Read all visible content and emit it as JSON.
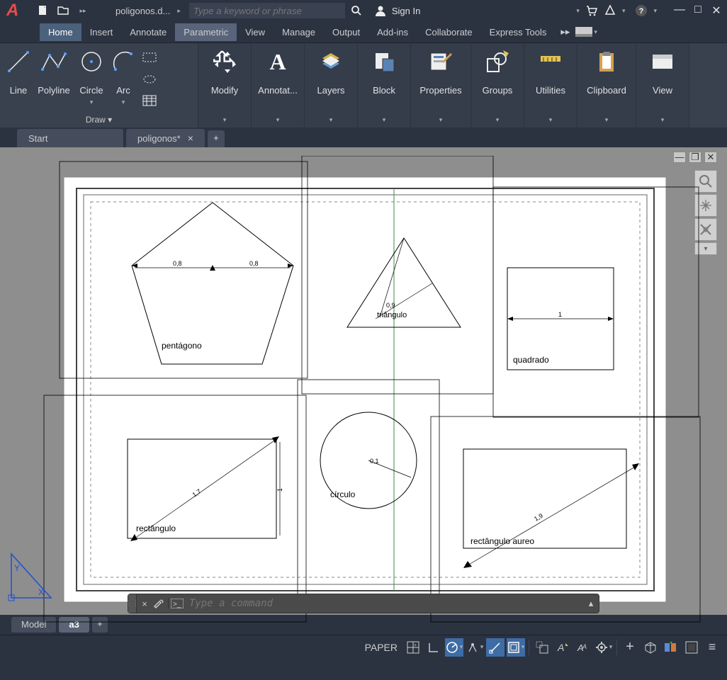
{
  "title": {
    "filename": "poligonos.d..."
  },
  "search": {
    "placeholder": "Type a keyword or phrase"
  },
  "signin": "Sign In",
  "menu": {
    "home": "Home",
    "insert": "Insert",
    "annotate": "Annotate",
    "parametric": "Parametric",
    "view": "View",
    "manage": "Manage",
    "output": "Output",
    "addins": "Add-ins",
    "collaborate": "Collaborate",
    "express": "Express Tools"
  },
  "ribbon": {
    "line": "Line",
    "polyline": "Polyline",
    "circle": "Circle",
    "arc": "Arc",
    "draw": "Draw ▾",
    "modify": "Modify",
    "annotation": "Annotat...",
    "layers": "Layers",
    "block": "Block",
    "properties": "Properties",
    "groups": "Groups",
    "utilities": "Utilities",
    "clipboard": "Clipboard",
    "view": "View"
  },
  "filetabs": {
    "start": "Start",
    "doc": "poligonos*"
  },
  "drawing": {
    "pentagon_label": "pentágono",
    "pentagon_dim1": "0,8",
    "pentagon_dim2": "0,8",
    "triangle_label": "triângulo",
    "triangle_dim": "0,9",
    "square_label": "quadrado",
    "square_dim": "1",
    "rect_label": "rectângulo",
    "rect_dim": "1,7",
    "rect_dim2": "1",
    "circle_label": "círculo",
    "circle_dim": "0,1",
    "golden_label": "rectângulo aureo",
    "golden_dim": "1,9"
  },
  "cmd": {
    "placeholder": "Type a command"
  },
  "layouts": {
    "model": "Model",
    "a3": "a3"
  },
  "status": {
    "paper": "PAPER"
  }
}
